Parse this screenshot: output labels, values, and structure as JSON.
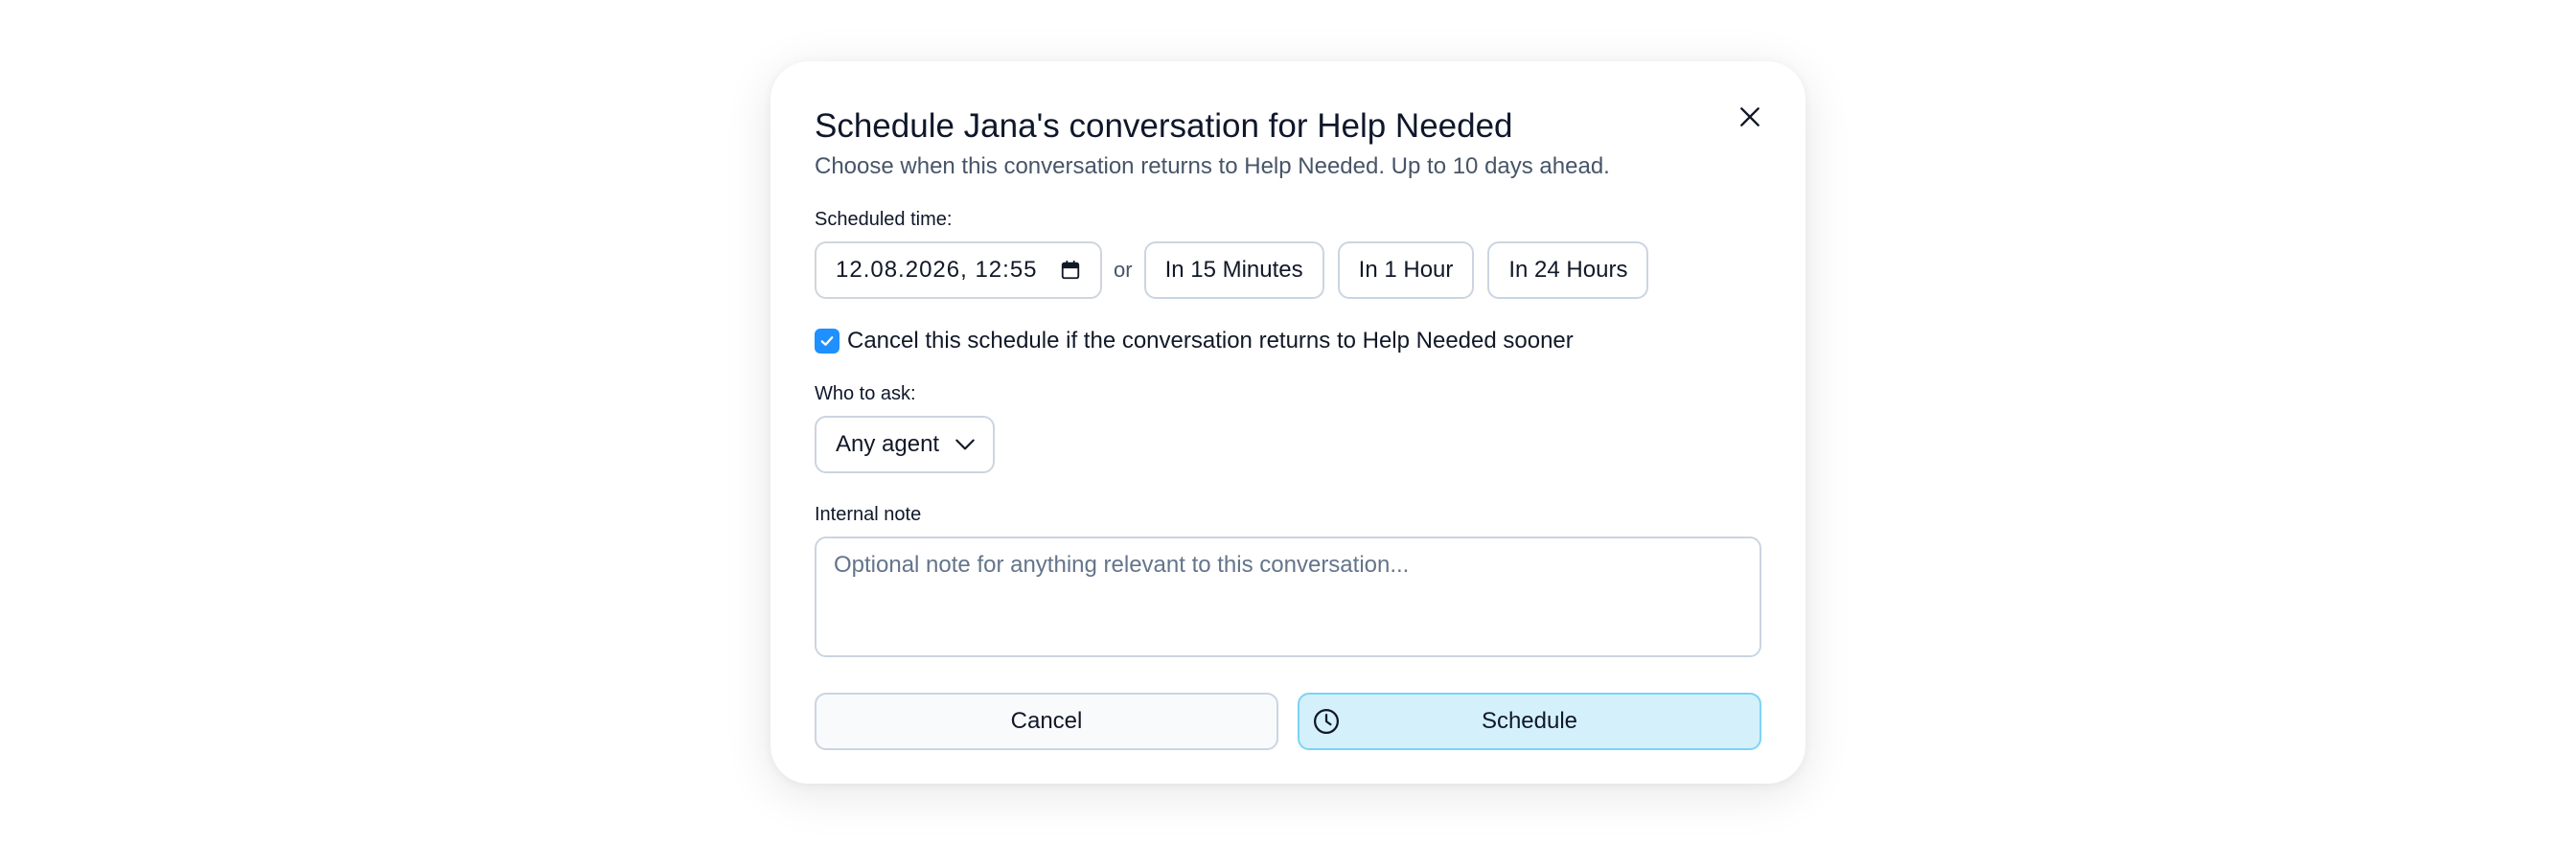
{
  "dialog": {
    "title": "Schedule Jana's conversation for Help Needed",
    "subtitle": "Choose when this conversation returns to Help Needed. Up to 10 days ahead.",
    "close_icon": "close-icon"
  },
  "scheduled_time": {
    "label": "Scheduled time:",
    "value": "12.08.2026, 12:55",
    "calendar_icon": "calendar-icon",
    "or_text": "or",
    "quick_options": [
      "In 15 Minutes",
      "In 1 Hour",
      "In 24 Hours"
    ]
  },
  "cancel_option": {
    "checked": true,
    "label": "Cancel this schedule if the conversation returns to Help Needed sooner"
  },
  "who_to_ask": {
    "label": "Who to ask:",
    "selected": "Any agent"
  },
  "internal_note": {
    "label": "Internal note",
    "placeholder": "Optional note for anything relevant to this conversation...",
    "value": ""
  },
  "actions": {
    "cancel_label": "Cancel",
    "schedule_label": "Schedule",
    "schedule_icon": "clock-icon"
  },
  "colors": {
    "checkbox": "#1e90ff",
    "schedule_bg": "#d4f0fb",
    "schedule_border": "#7dd3f5",
    "cancel_bg": "#f8fafc"
  }
}
